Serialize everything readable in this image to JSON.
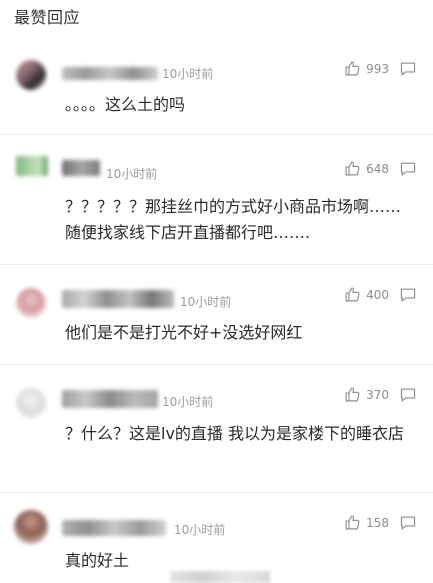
{
  "section_title": "最赞回应",
  "comments": [
    {
      "time": "10小时前",
      "likes": "993",
      "text": "。。。。这么土的吗"
    },
    {
      "time": "10小时前",
      "likes": "648",
      "text": "？？？？？那挂丝巾的方式好小商品市场啊……随便找家线下店开直播都行吧……."
    },
    {
      "time": "10小时前",
      "likes": "400",
      "text": "他们是不是打光不好+没选好网红"
    },
    {
      "time": "10小时前",
      "likes": "370",
      "text": "？什么？这是lv的直播 我以为是家楼下的睡衣店"
    },
    {
      "time": "10小时前",
      "likes": "158",
      "text": "真的好土"
    }
  ],
  "icons": {
    "like": "thumbs-up-icon",
    "reply": "comment-bubble-icon"
  },
  "colors": {
    "text": "#2a2a2a",
    "meta": "#9b9b9b",
    "divider": "#ececec"
  }
}
